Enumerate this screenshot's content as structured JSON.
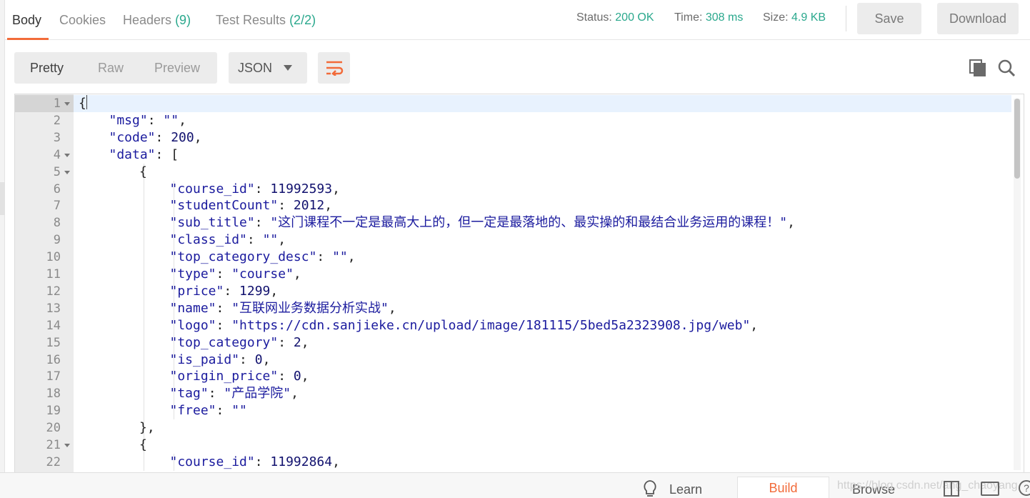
{
  "response_tabs": [
    {
      "label": "Body",
      "count": ""
    },
    {
      "label": "Cookies",
      "count": ""
    },
    {
      "label": "Headers",
      "count": "(9)"
    },
    {
      "label": "Test Results",
      "count": "(2/2)"
    }
  ],
  "status": {
    "status_label": "Status:",
    "status_value": "200 OK",
    "time_label": "Time:",
    "time_value": "308 ms",
    "size_label": "Size:",
    "size_value": "4.9 KB"
  },
  "actions": {
    "save": "Save",
    "download": "Download"
  },
  "view_modes": [
    "Pretty",
    "Raw",
    "Preview"
  ],
  "format": "JSON",
  "icons": {
    "wrap": "wrap-lines-icon",
    "copy": "copy-icon",
    "search": "search-icon",
    "bulb": "lightbulb-icon",
    "layout": "two-pane-layout-icon",
    "keyboard": "keyboard-icon",
    "help": "help-icon"
  },
  "colors": {
    "accent": "#f26b3a",
    "status_green": "#2aa88d",
    "json_string": "#1b1b9e"
  },
  "code_lines": [
    {
      "n": "1",
      "fold": true,
      "indent": 0,
      "t": [
        [
          "p",
          "{"
        ]
      ]
    },
    {
      "n": "2",
      "fold": false,
      "indent": 1,
      "t": [
        [
          "k",
          "\"msg\""
        ],
        [
          "p",
          ": "
        ],
        [
          "s",
          "\"\""
        ],
        [
          "p",
          ","
        ]
      ]
    },
    {
      "n": "3",
      "fold": false,
      "indent": 1,
      "t": [
        [
          "k",
          "\"code\""
        ],
        [
          "p",
          ": "
        ],
        [
          "n",
          "200"
        ],
        [
          "p",
          ","
        ]
      ]
    },
    {
      "n": "4",
      "fold": true,
      "indent": 1,
      "t": [
        [
          "k",
          "\"data\""
        ],
        [
          "p",
          ": ["
        ]
      ]
    },
    {
      "n": "5",
      "fold": true,
      "indent": 2,
      "t": [
        [
          "p",
          "{"
        ]
      ]
    },
    {
      "n": "6",
      "fold": false,
      "indent": 3,
      "t": [
        [
          "k",
          "\"course_id\""
        ],
        [
          "p",
          ": "
        ],
        [
          "n",
          "11992593"
        ],
        [
          "p",
          ","
        ]
      ]
    },
    {
      "n": "7",
      "fold": false,
      "indent": 3,
      "t": [
        [
          "k",
          "\"studentCount\""
        ],
        [
          "p",
          ": "
        ],
        [
          "n",
          "2012"
        ],
        [
          "p",
          ","
        ]
      ]
    },
    {
      "n": "8",
      "fold": false,
      "indent": 3,
      "t": [
        [
          "k",
          "\"sub_title\""
        ],
        [
          "p",
          ": "
        ],
        [
          "s",
          "\"这门课程不一定是最高大上的，但一定是最落地的、最实操的和最结合业务运用的课程！\""
        ],
        [
          "p",
          ","
        ]
      ]
    },
    {
      "n": "9",
      "fold": false,
      "indent": 3,
      "t": [
        [
          "k",
          "\"class_id\""
        ],
        [
          "p",
          ": "
        ],
        [
          "s",
          "\"\""
        ],
        [
          "p",
          ","
        ]
      ]
    },
    {
      "n": "10",
      "fold": false,
      "indent": 3,
      "t": [
        [
          "k",
          "\"top_category_desc\""
        ],
        [
          "p",
          ": "
        ],
        [
          "s",
          "\"\""
        ],
        [
          "p",
          ","
        ]
      ]
    },
    {
      "n": "11",
      "fold": false,
      "indent": 3,
      "t": [
        [
          "k",
          "\"type\""
        ],
        [
          "p",
          ": "
        ],
        [
          "s",
          "\"course\""
        ],
        [
          "p",
          ","
        ]
      ]
    },
    {
      "n": "12",
      "fold": false,
      "indent": 3,
      "t": [
        [
          "k",
          "\"price\""
        ],
        [
          "p",
          ": "
        ],
        [
          "n",
          "1299"
        ],
        [
          "p",
          ","
        ]
      ]
    },
    {
      "n": "13",
      "fold": false,
      "indent": 3,
      "t": [
        [
          "k",
          "\"name\""
        ],
        [
          "p",
          ": "
        ],
        [
          "s",
          "\"互联网业务数据分析实战\""
        ],
        [
          "p",
          ","
        ]
      ]
    },
    {
      "n": "14",
      "fold": false,
      "indent": 3,
      "t": [
        [
          "k",
          "\"logo\""
        ],
        [
          "p",
          ": "
        ],
        [
          "s",
          "\"https://cdn.sanjieke.cn/upload/image/181115/5bed5a2323908.jpg/web\""
        ],
        [
          "p",
          ","
        ]
      ]
    },
    {
      "n": "15",
      "fold": false,
      "indent": 3,
      "t": [
        [
          "k",
          "\"top_category\""
        ],
        [
          "p",
          ": "
        ],
        [
          "n",
          "2"
        ],
        [
          "p",
          ","
        ]
      ]
    },
    {
      "n": "16",
      "fold": false,
      "indent": 3,
      "t": [
        [
          "k",
          "\"is_paid\""
        ],
        [
          "p",
          ": "
        ],
        [
          "n",
          "0"
        ],
        [
          "p",
          ","
        ]
      ]
    },
    {
      "n": "17",
      "fold": false,
      "indent": 3,
      "t": [
        [
          "k",
          "\"origin_price\""
        ],
        [
          "p",
          ": "
        ],
        [
          "n",
          "0"
        ],
        [
          "p",
          ","
        ]
      ]
    },
    {
      "n": "18",
      "fold": false,
      "indent": 3,
      "t": [
        [
          "k",
          "\"tag\""
        ],
        [
          "p",
          ": "
        ],
        [
          "s",
          "\"产品学院\""
        ],
        [
          "p",
          ","
        ]
      ]
    },
    {
      "n": "19",
      "fold": false,
      "indent": 3,
      "t": [
        [
          "k",
          "\"free\""
        ],
        [
          "p",
          ": "
        ],
        [
          "s",
          "\"\""
        ]
      ]
    },
    {
      "n": "20",
      "fold": false,
      "indent": 2,
      "t": [
        [
          "p",
          "},"
        ]
      ]
    },
    {
      "n": "21",
      "fold": true,
      "indent": 2,
      "t": [
        [
          "p",
          "{"
        ]
      ]
    },
    {
      "n": "22",
      "fold": false,
      "indent": 3,
      "t": [
        [
          "k",
          "\"course_id\""
        ],
        [
          "p",
          ": "
        ],
        [
          "n",
          "11992864"
        ],
        [
          "p",
          ","
        ]
      ]
    }
  ],
  "bottom": {
    "learn": "Learn",
    "build": "Build",
    "browse": "Browse",
    "watermark": "https://blog.csdn.net/ang_chaoyang"
  }
}
